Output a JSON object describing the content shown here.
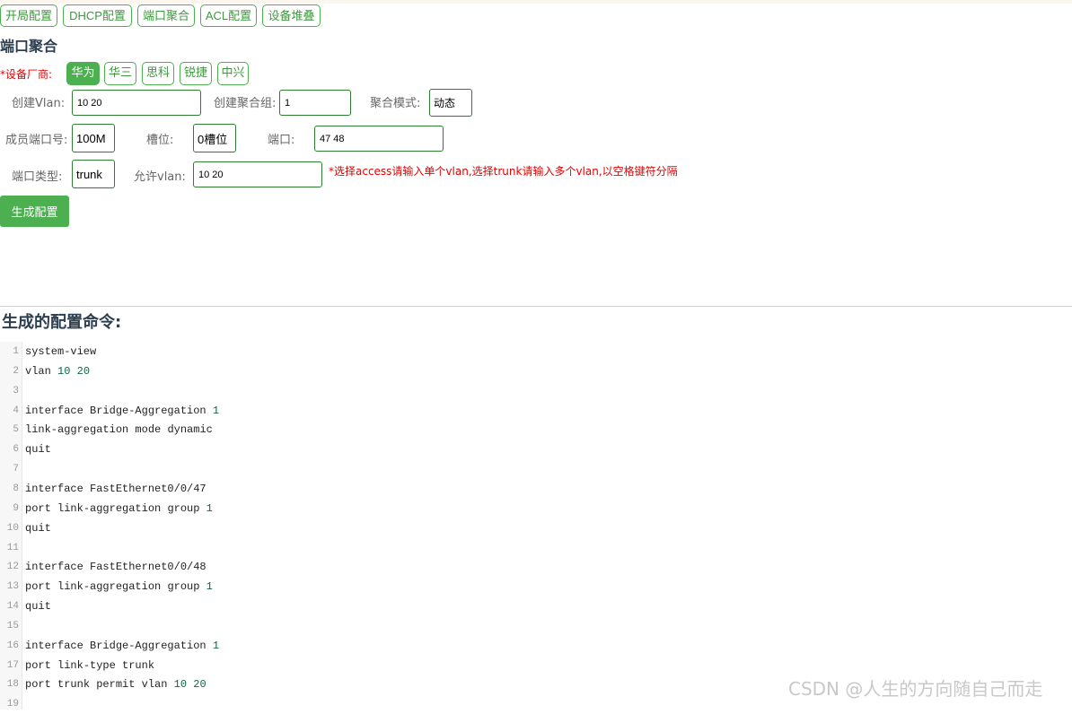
{
  "nav": [
    "开局配置",
    "DHCP配置",
    "端口聚合",
    "ACL配置",
    "设备堆叠"
  ],
  "page_title": "端口聚合",
  "vendor": {
    "label": "*设备厂商:",
    "options": [
      "华为",
      "华三",
      "思科",
      "锐捷",
      "中兴"
    ],
    "selected": "华为"
  },
  "form": {
    "vlan_label": "创建Vlan:",
    "vlan_value": "10 20",
    "group_label": "创建聚合组:",
    "group_value": "1",
    "mode_label": "聚合模式:",
    "mode_value": "动态",
    "member_label": "成员端口号:",
    "member_value": "100M",
    "slot_label": "槽位:",
    "slot_value": "0槽位",
    "port_label": "端口:",
    "port_value": "47 48",
    "type_label": "端口类型:",
    "type_value": "trunk",
    "allow_label": "允许vlan:",
    "allow_value": "10 20",
    "hint": "*选择access请输入单个vlan,选择trunk请输入多个vlan,以空格键符分隔"
  },
  "generate_button": "生成配置",
  "output_title": "生成的配置命令:",
  "code_lines": [
    "system-view",
    "vlan 10 20",
    "",
    "interface Bridge-Aggregation 1",
    "link-aggregation mode dynamic",
    "quit",
    "",
    "interface FastEthernet0/0/47",
    "port link-aggregation group 1",
    "quit",
    "",
    "interface FastEthernet0/0/48",
    "port link-aggregation group 1",
    "quit",
    "",
    "interface Bridge-Aggregation 1",
    "port link-type trunk",
    "port trunk permit vlan 10 20",
    ""
  ],
  "watermark": "CSDN @人生的方向随自己而走",
  "colors": {
    "accent": "#4caf50",
    "warning": "#e60000",
    "heading": "#2c3e50",
    "code_number": "#116644"
  }
}
